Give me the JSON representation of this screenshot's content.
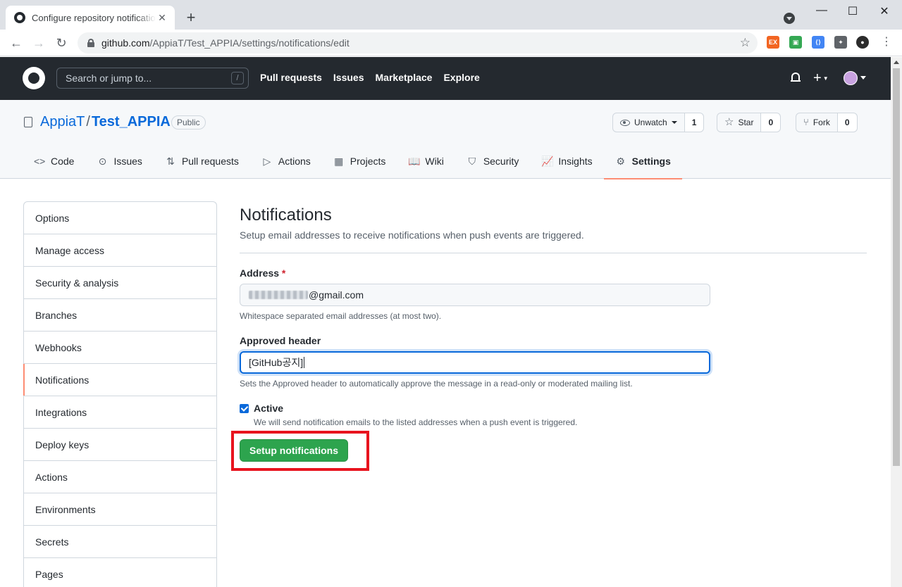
{
  "browser": {
    "tab_title": "Configure repository notifications",
    "tab_close": "✕",
    "new_tab": "+",
    "url_host": "github.com",
    "url_path": "/AppiaT/Test_APPIA/settings/notifications/edit",
    "back": "←",
    "forward": "→",
    "reload": "↻",
    "minimize": "—",
    "maximize": "☐",
    "close": "✕",
    "bookmark_star": "☆",
    "menu": "⋮",
    "extensions": [
      {
        "label": "EX",
        "color": "#f26522"
      },
      {
        "label": "▣",
        "color": "#34a853"
      },
      {
        "label": "⟨⟩",
        "color": "#4285f4"
      },
      {
        "label": "✦",
        "color": "#5f6368"
      },
      {
        "label": "●",
        "color": "#2b2b2b"
      }
    ]
  },
  "github": {
    "search_placeholder": "Search or jump to...",
    "search_shortcut": "/",
    "nav": [
      "Pull requests",
      "Issues",
      "Marketplace",
      "Explore"
    ],
    "plus": "+"
  },
  "repo": {
    "owner": "AppiaT",
    "separator": "/",
    "name": "Test_APPIA",
    "visibility": "Public",
    "unwatch_label": "Unwatch",
    "watch_count": "1",
    "star_label": "Star",
    "star_count": "0",
    "fork_label": "Fork",
    "fork_count": "0",
    "tabs": [
      {
        "label": "Code",
        "icon": "<>"
      },
      {
        "label": "Issues",
        "icon": "⊙"
      },
      {
        "label": "Pull requests",
        "icon": "⇅"
      },
      {
        "label": "Actions",
        "icon": "▷"
      },
      {
        "label": "Projects",
        "icon": "▦"
      },
      {
        "label": "Wiki",
        "icon": "📖"
      },
      {
        "label": "Security",
        "icon": "⛉"
      },
      {
        "label": "Insights",
        "icon": "📈"
      },
      {
        "label": "Settings",
        "icon": "⚙"
      }
    ]
  },
  "sidebar": {
    "items": [
      "Options",
      "Manage access",
      "Security & analysis",
      "Branches",
      "Webhooks",
      "Notifications",
      "Integrations",
      "Deploy keys",
      "Actions",
      "Environments",
      "Secrets",
      "Pages"
    ],
    "active": "Notifications"
  },
  "main": {
    "title": "Notifications",
    "description": "Setup email addresses to receive notifications when push events are triggered.",
    "address_label": "Address",
    "required_mark": "*",
    "address_value": "@gmail.com",
    "address_note": "Whitespace separated email addresses (at most two).",
    "header_label": "Approved header",
    "header_value": "[GitHub공지]",
    "header_note": "Sets the Approved header to automatically approve the message in a read-only or moderated mailing list.",
    "active_label": "Active",
    "active_checked": true,
    "active_note": "We will send notification emails to the listed addresses when a push event is triggered.",
    "submit_label": "Setup notifications"
  },
  "colors": {
    "header_bg": "#24292f",
    "primary_button": "#2da44e",
    "selected_tab_underline": "#fd8c73",
    "link": "#0969da",
    "annotation_box": "#e8141e"
  }
}
